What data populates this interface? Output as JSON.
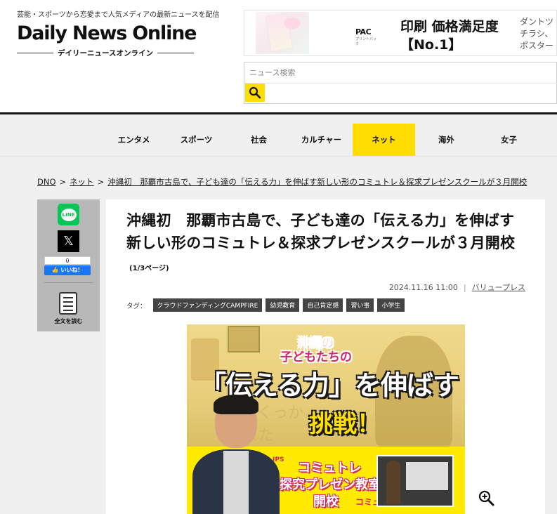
{
  "header": {
    "tagline": "芸能・スポーツから恋愛まで人気メディアの最新ニュースを配信",
    "logo": "Daily News Online",
    "logo_sub": "デイリーニュースオンライン"
  },
  "ad": {
    "brand": "PAC",
    "brand_sub": "プリントパック",
    "title": "印刷 価格満足度",
    "title2": "【No.1】",
    "side_line1": "ダントツ",
    "side_line2": "チラシ、",
    "side_line3": "ポスター"
  },
  "search": {
    "placeholder": "ニュース検索"
  },
  "nav": {
    "items": [
      {
        "label": "エンタメ"
      },
      {
        "label": "スポーツ"
      },
      {
        "label": "社会"
      },
      {
        "label": "カルチャー"
      },
      {
        "label": "ネット"
      },
      {
        "label": "海外"
      },
      {
        "label": "女子"
      }
    ],
    "active": "ネット"
  },
  "breadcrumb": {
    "home": "DNO",
    "sep": ">",
    "category": "ネット",
    "current": "沖縄初　那覇市古島で、子ども達の「伝える力」を伸ばす新しい形のコミュトレ＆探求プレゼンスクールが３月開校"
  },
  "share": {
    "line_label": "LINE",
    "x_label": "𝕏",
    "like_count": "0",
    "like_label": "👍 いいね！",
    "fulltext_label": "全文を読む"
  },
  "article": {
    "title": "沖縄初　那覇市古島で、子ども達の「伝える力」を伸ばす新しい形のコミュトレ＆探求プレゼンスクールが３月開校",
    "page_indicator": "(1/3ページ)",
    "date": "2024.11.16 11:00",
    "source": "バリュープレス",
    "tags_label": "タグ：",
    "tags": [
      {
        "label": "クラウドファンディングCAMPFIRE"
      },
      {
        "label": "幼児教育"
      },
      {
        "label": "自己肯定感"
      },
      {
        "label": "習い事"
      },
      {
        "label": "小学生"
      }
    ]
  },
  "hero": {
    "sub1": "沖縄の",
    "sub2": "子どもたちの",
    "main": "「伝える力」を伸ばす",
    "challenge": "挑戦！",
    "faint1": "くっか",
    "faint2": "れた",
    "band1": "コミュトレ",
    "band2": "探究プレゼン教室",
    "band3": "開校",
    "band_logo": "IPS",
    "band_logo2": "コミュ"
  },
  "colors": {
    "accent": "#ffdd00",
    "header_rule": "#111111",
    "page_bg": "#f0f0f0",
    "share_bg": "#b8b8b8",
    "line_green": "#06c755",
    "fb_blue": "#1877f2",
    "tag_bg": "#444444"
  },
  "icons": {
    "search": "magnifier-icon",
    "zoom": "zoom-in-icon",
    "fulltext": "document-icon"
  }
}
